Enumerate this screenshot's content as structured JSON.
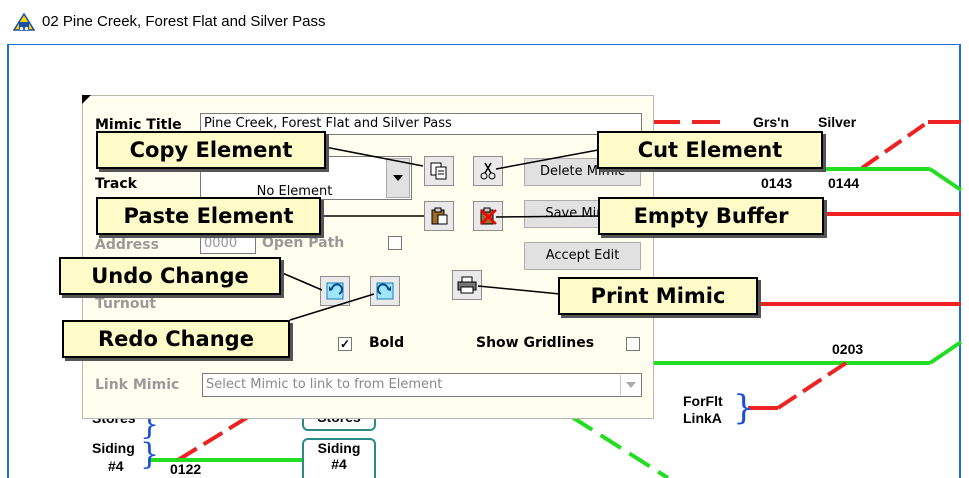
{
  "window": {
    "title": "02 Pine Creek, Forest Flat and Silver Pass",
    "icon": "app-logo-icon"
  },
  "colors": {
    "track_green": "#22dd22",
    "track_red": "#ee2222",
    "callout_bg": "#fffbc8",
    "panel_bg": "#fffff0"
  },
  "mimic": {
    "labels": {
      "grosn": "Grs'n",
      "silver": "Silver",
      "t0143": "0143",
      "t0144": "0144",
      "t0203": "0203",
      "forflt": "ForFlt",
      "linka": "LinkA",
      "stores_left": "Stores",
      "siding_left": "Siding",
      "num4_left": "#4",
      "t0122": "0122",
      "stores_mid": "Stores",
      "siding_mid": "Siding",
      "num4_mid": "#4"
    }
  },
  "editor": {
    "mimic_title_label": "Mimic Title",
    "mimic_title_value": "Pine Creek, Forest Flat and Silver Pass",
    "track_label": "Track",
    "element_value": "No Element",
    "address_label": "Address",
    "address_value": "0000",
    "open_path_label": "Open Path",
    "turnout_label": "Turnout",
    "bold_label": "Bold",
    "show_gridlines_label": "Show Gridlines",
    "link_mimic_label": "Link Mimic",
    "link_mimic_placeholder": "Select Mimic to link to from Element",
    "delete_mimic_label": "Delete Mimic",
    "save_mimic_label": "Save Mimic",
    "accept_edit_label": "Accept Edit"
  },
  "callouts": {
    "copy": "Copy Element",
    "cut": "Cut Element",
    "paste": "Paste Element",
    "empty": "Empty Buffer",
    "undo": "Undo Change",
    "redo": "Redo Change",
    "print": "Print Mimic"
  }
}
